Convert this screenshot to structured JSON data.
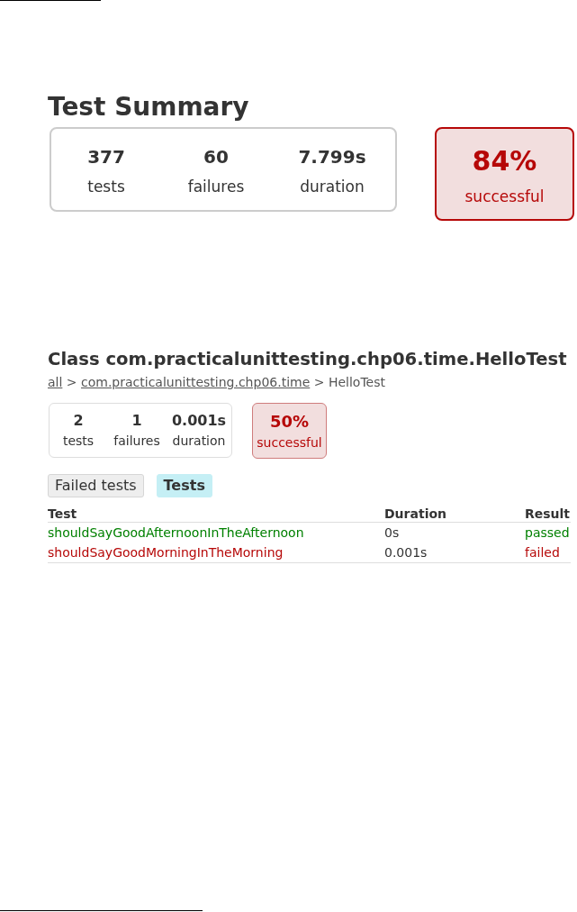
{
  "summary": {
    "title": "Test Summary",
    "counters": [
      {
        "value": "377",
        "label": "tests"
      },
      {
        "value": "60",
        "label": "failures"
      },
      {
        "value": "7.799s",
        "label": "duration"
      }
    ],
    "success": {
      "value": "84%",
      "label": "successful",
      "failed": true
    }
  },
  "class_report": {
    "title": "Class com.practicalunittesting.chp06.time.HelloTest",
    "breadcrumb": [
      {
        "kind": "link",
        "text": "all"
      },
      {
        "kind": "separator",
        "text": ">"
      },
      {
        "kind": "link",
        "text": "com.practicalunittesting.chp06.time"
      },
      {
        "kind": "separator",
        "text": ">"
      },
      {
        "kind": "current",
        "text": "HelloTest"
      }
    ],
    "counters": [
      {
        "value": "2",
        "label": "tests"
      },
      {
        "value": "1",
        "label": "failures"
      },
      {
        "value": "0.001s",
        "label": "duration"
      }
    ],
    "success": {
      "value": "50%",
      "label": "successful",
      "failed": true
    },
    "tabs": [
      {
        "label": "Failed tests",
        "selected": false
      },
      {
        "label": "Tests",
        "selected": true
      }
    ],
    "table": {
      "columns": [
        "Test",
        "Duration",
        "Result"
      ],
      "rows": [
        {
          "test": "shouldSayGoodAfternoonInTheAfternoon",
          "duration": "0s",
          "result": "passed",
          "failed": false
        },
        {
          "test": "shouldSayGoodMorningInTheMorning",
          "duration": "0.001s",
          "result": "failed",
          "failed": true
        }
      ]
    }
  }
}
